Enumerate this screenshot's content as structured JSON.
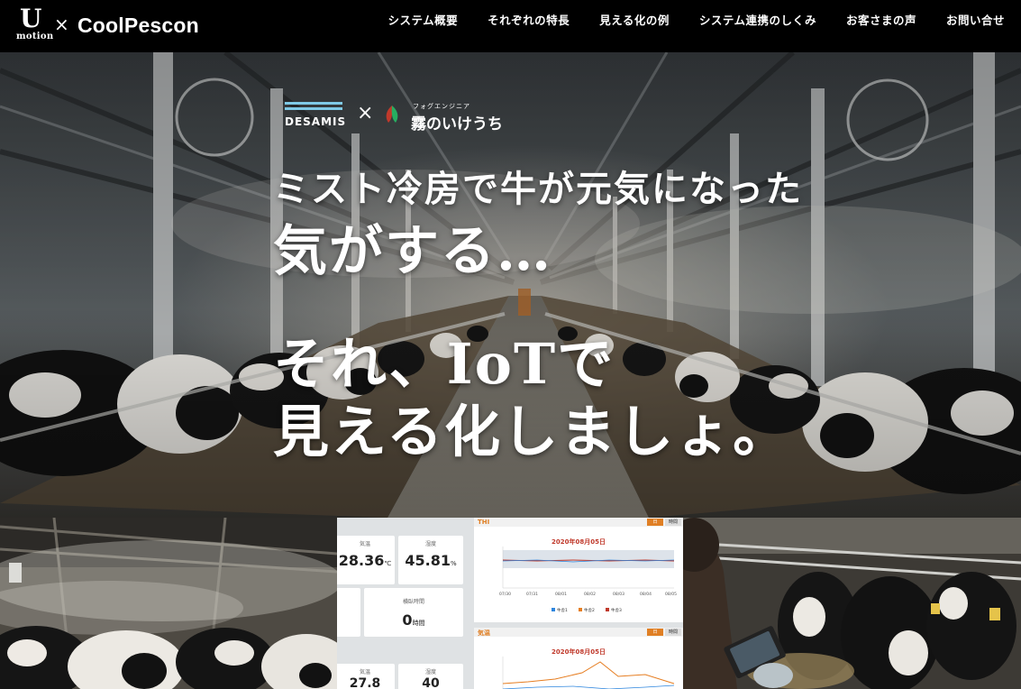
{
  "header": {
    "logo": {
      "u": "U",
      "motion": "motion",
      "times": "×",
      "brand": "CoolPescon"
    },
    "nav": [
      {
        "label": "システム概要"
      },
      {
        "label": "それぞれの特長"
      },
      {
        "label": "見える化の例"
      },
      {
        "label": "システム連携のしくみ"
      },
      {
        "label": "お客さまの声"
      },
      {
        "label": "お問い合せ"
      }
    ]
  },
  "hero": {
    "partner_left": "DESAMIS",
    "partner_times": "×",
    "partner_right_ruby": "フォグエンジニア",
    "partner_right": "霧のいけうち",
    "line1": "ミスト冷房で牛が元気になった",
    "line2": "気がする…",
    "line3": "それ、IoTで",
    "line4": "見える化しましょ。"
  },
  "dashboard": {
    "temp_label": "気温",
    "temp_value": "28.36",
    "temp_unit": "℃",
    "humidity_label": "湿度",
    "humidity_value": "45.81",
    "humidity_unit": "%",
    "rest_label": "横臥時間",
    "rest_value": "0",
    "rest_unit": "時間",
    "temp2_label": "気温",
    "temp2_value": "27.8",
    "humidity2_label": "湿度",
    "humidity2_value": "40",
    "thi_title": "THI",
    "thi_date": "2020年08月05日",
    "temp_chart_title": "気温",
    "temp_chart_date": "2020年08月05日",
    "tag_day": "日",
    "tag_hour": "時間",
    "thi_axis_dates": [
      "07/30",
      "07/31",
      "08/01",
      "08/02",
      "08/03",
      "08/04",
      "08/05"
    ],
    "thi_legend": [
      "牛舎1",
      "牛舎2",
      "牛舎3"
    ],
    "colors": {
      "accent": "#e07f24",
      "series1": "#2e86de",
      "series2": "#e67e22",
      "series3": "#c0392b"
    }
  }
}
